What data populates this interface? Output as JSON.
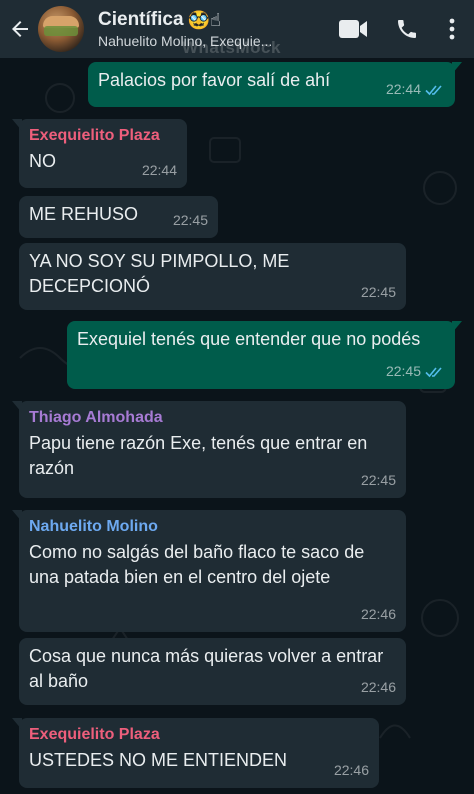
{
  "header": {
    "title": "Científica",
    "title_emojis": "🥸☝",
    "subtitle": "Nahuelito Molino, Exequie...",
    "watermark": "WhatsMock",
    "icons": [
      "back-arrow-icon",
      "video-call-icon",
      "phone-icon",
      "more-options-icon"
    ]
  },
  "colors": {
    "header_bg": "#1f2c34",
    "chat_bg": "#0b141a",
    "incoming_bubble": "#1f2c34",
    "outgoing_bubble": "#005c4b",
    "read_ticks": "#53bdeb",
    "sender_exequielito": "#ee5f7c",
    "sender_thiago": "#a77bd4",
    "sender_nahuelito": "#6da9f0"
  },
  "messages": [
    {
      "dir": "out",
      "text": "Palacios por favor salí de ahí",
      "time": "22:44",
      "read": true
    },
    {
      "dir": "in",
      "sender": "Exequielito Plaza",
      "text": "NO",
      "time": "22:44"
    },
    {
      "dir": "in",
      "text": "ME REHUSO",
      "time": "22:45"
    },
    {
      "dir": "in",
      "text": "YA NO SOY SU PIMPOLLO, ME DECEPCIONÓ",
      "time": "22:45"
    },
    {
      "dir": "out",
      "text": "Exequiel tenés que entender que no podés",
      "time": "22:45",
      "read": true
    },
    {
      "dir": "in",
      "sender": "Thiago Almohada",
      "text": "Papu tiene razón Exe, tenés que entrar en razón",
      "time": "22:45"
    },
    {
      "dir": "in",
      "sender": "Nahuelito Molino",
      "text": "Como no salgás del baño flaco te saco de una patada bien en el centro del ojete",
      "time": "22:46"
    },
    {
      "dir": "in",
      "text": "Cosa que nunca más quieras volver a entrar al baño",
      "time": "22:46"
    },
    {
      "dir": "in",
      "sender": "Exequielito Plaza",
      "text": "USTEDES NO ME ENTIENDEN",
      "time": "22:46"
    }
  ]
}
